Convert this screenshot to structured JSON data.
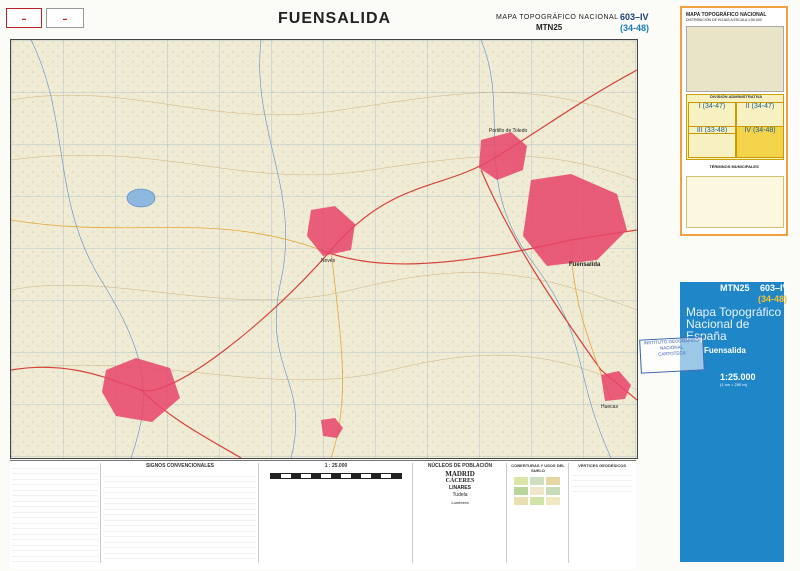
{
  "header": {
    "title": "FUENSALIDA",
    "series_line1": "MAPA TOPOGRÁFICO NACIONAL",
    "series_line2": "MTN25",
    "sheet_number": "603–IV",
    "sheet_sub": "(34-48)"
  },
  "map": {
    "towns": [
      {
        "name": "Fuensalida",
        "kind": "large"
      },
      {
        "name": "Portillo de Toledo",
        "kind": "medium"
      },
      {
        "name": "Novés",
        "kind": "medium"
      },
      {
        "name": "Huecas",
        "kind": "small"
      }
    ],
    "colors": {
      "terrain": "#efebd4",
      "urban": "#e8446a",
      "water": "#8fb8e0",
      "road": "#d6423c"
    }
  },
  "legend": {
    "signos_title": "SIGNOS CONVENCIONALES",
    "scale_label": "1 : 25.000",
    "nucleos_title": "NÚCLEOS DE POBLACIÓN",
    "nucleos_examples": [
      "MADRID",
      "CÁCERES",
      "LINARES",
      "Tudela",
      "Lumbrera"
    ],
    "cobertura_title": "COBERTURAS Y USOS DEL SUELO",
    "vertices_title": "VÉRTICES GEODÉSICOS"
  },
  "index_card": {
    "title": "MAPA TOPOGRÁFICO NACIONAL",
    "subtitle": "DISTRIBUCIÓN DE HOJAS A ESCALA 1:50.000",
    "admin_title": "DIVISIÓN ADMINISTRATIVA",
    "quadrants": [
      "I (34-47)",
      "II (34-47)",
      "III (33-48)",
      "IV (34-48)"
    ],
    "municipios_title": "TÉRMINOS MUNICIPALES"
  },
  "cover": {
    "mtn": "MTN25",
    "sheet_number": "603–IV",
    "sheet_sub": "(34-48)",
    "title": "Mapa Topográfico Nacional de España",
    "name": "Fuensalida",
    "scale": "1:25.000",
    "scale_note": "(1 cm = 250 m)"
  },
  "stamp": {
    "line1": "INSTITUTO GEOGRÁFICO",
    "line2": "NACIONAL",
    "line3": "CARTOTECA"
  }
}
